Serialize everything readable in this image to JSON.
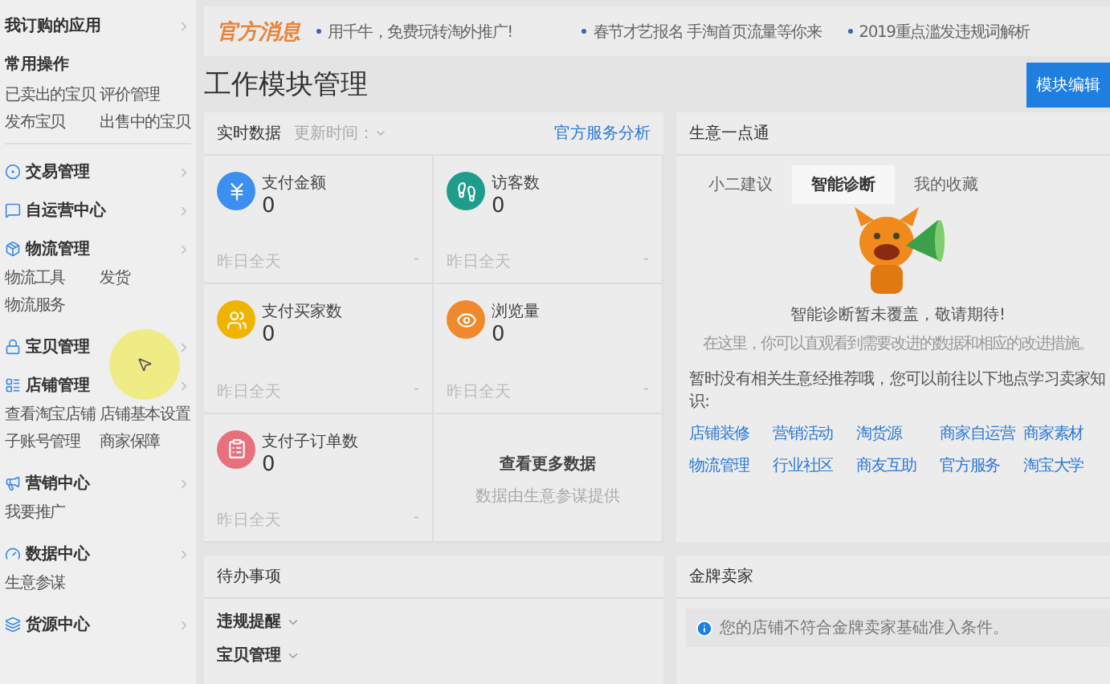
{
  "sidebar": {
    "subscribed": "我订购的应用",
    "common": {
      "title": "常用操作",
      "links": [
        "已卖出的宝贝",
        "评价管理",
        "发布宝贝",
        "出售中的宝贝"
      ]
    },
    "sections": [
      {
        "label": "交易管理"
      },
      {
        "label": "自运营中心"
      },
      {
        "label": "物流管理",
        "links": [
          "物流工具",
          "发货",
          "物流服务"
        ]
      },
      {
        "label": "宝贝管理"
      },
      {
        "label": "店铺管理",
        "links": [
          "查看淘宝店铺",
          "店铺基本设置",
          "子账号管理",
          "商家保障"
        ]
      },
      {
        "label": "营销中心",
        "links": [
          "我要推广"
        ]
      },
      {
        "label": "数据中心",
        "links": [
          "生意参谋"
        ]
      },
      {
        "label": "货源中心"
      }
    ]
  },
  "notices": {
    "title": "官方消息",
    "items": [
      "用千牛，免费玩转淘外推广!",
      "春节才艺报名 手淘首页流量等你来",
      "2019重点滥发违规词解析"
    ]
  },
  "page_title": "工作模块管理",
  "edit_button": "模块编辑",
  "realtime": {
    "title": "实时数据",
    "update_time": "更新时间：",
    "link": "官方服务分析",
    "metrics": [
      {
        "label": "支付金额",
        "value": "0",
        "footer": "昨日全天",
        "delta": "-",
        "color": "#3b8ff0"
      },
      {
        "label": "访客数",
        "value": "0",
        "footer": "昨日全天",
        "delta": "-",
        "color": "#1e9e8a"
      },
      {
        "label": "支付买家数",
        "value": "0",
        "footer": "昨日全天",
        "delta": "-",
        "color": "#efb400"
      },
      {
        "label": "浏览量",
        "value": "0",
        "footer": "昨日全天",
        "delta": "-",
        "color": "#ef8a2c"
      },
      {
        "label": "支付子订单数",
        "value": "0",
        "footer": "昨日全天",
        "delta": "-",
        "color": "#e8707c"
      }
    ],
    "more": {
      "title": "查看更多数据",
      "note": "数据由生意参谋提供"
    }
  },
  "business": {
    "title": "生意一点通",
    "tabs": [
      {
        "label": "小二建议",
        "selected": false
      },
      {
        "label": "智能诊断",
        "selected": true
      },
      {
        "label": "我的收藏",
        "selected": false
      }
    ],
    "message": "智能诊断暂未覆盖，敬请期待!",
    "sub": "在这里，你可以直观看到需要改进的数据和相应的改进措施。",
    "prompt": "暂时没有相关生意经推荐哦，您可以前往以下地点学习卖家知识:",
    "links": [
      "店铺装修",
      "营销活动",
      "淘货源",
      "商家自运营",
      "商家素材",
      "物流管理",
      "行业社区",
      "商友互助",
      "官方服务",
      "淘宝大学"
    ]
  },
  "todo": {
    "title": "待办事项",
    "items": [
      "违规提醒",
      "宝贝管理"
    ]
  },
  "gold": {
    "title": "金牌卖家",
    "info": "您的店铺不符合金牌卖家基础准入条件。"
  }
}
